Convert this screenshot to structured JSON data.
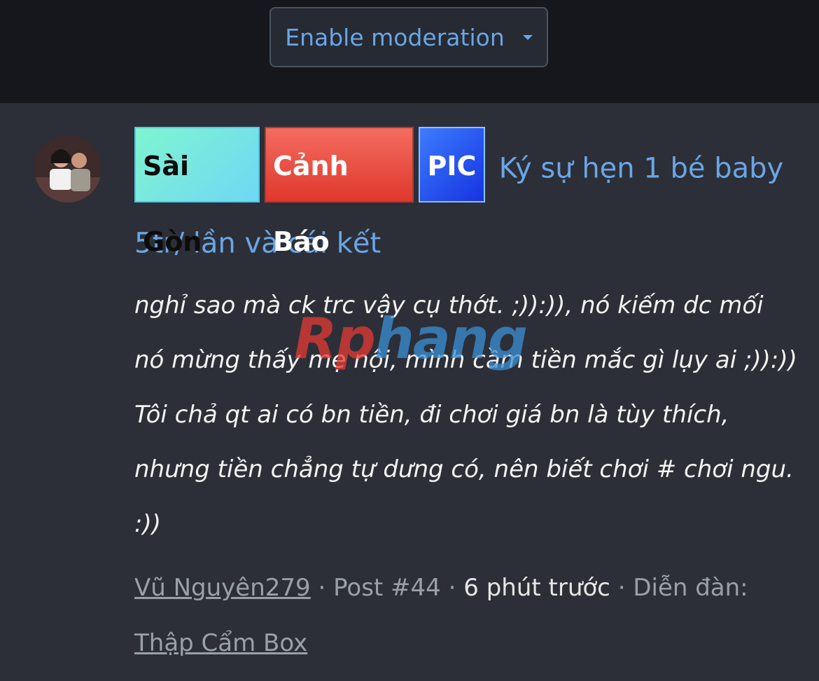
{
  "header": {
    "moderation_label": "Enable moderation"
  },
  "thread": {
    "prefixes": [
      "Sài Gòn",
      "Cảnh Báo",
      "PIC"
    ],
    "title": "Ký sự hẹn 1 bé baby 5tr/ lần và cái kết",
    "body": "nghỉ sao mà ck trc vậy cụ thớt. ;)):)), nó kiếm dc mối nó mừng thấy mẹ nội, mình cầm tiền mắc gì lụy ai ;)):)) Tôi chả qt ai có bn tiền, đi chơi giá bn là tùy thích, nhưng tiền chẳng tự dưng có, nên biết chơi # chơi ngu. :))",
    "watermark": "Rphang",
    "author": "Vũ Nguyên279",
    "sep": "·",
    "post_number": "Post #44",
    "time": "6 phút trước",
    "forum_label": "Diễn đàn:",
    "forum": "Thập Cẩm Box"
  },
  "colors": {
    "link": "#6aa5e6",
    "background": "#2c2f37",
    "topbar": "#15171c"
  }
}
